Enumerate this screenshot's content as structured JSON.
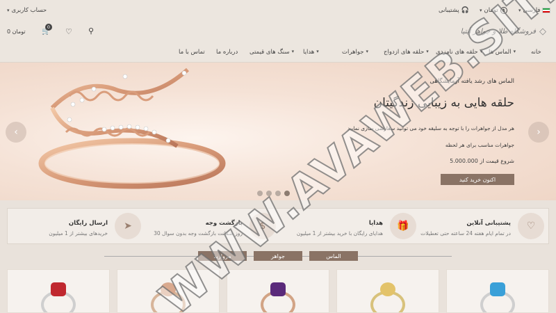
{
  "topbar": {
    "account_label": "حساب کاربری",
    "support_label": "پشتیبانی",
    "currency_label": "تومان",
    "language_label": "فارسی"
  },
  "header": {
    "logo_text": "فروشگاه طلا و جواهر آیتیا",
    "cart_count": "0",
    "cart_total": "0 تومان"
  },
  "nav": {
    "items": [
      "خانه",
      "الماس ها",
      "حلقه های نامزدی",
      "حلقه های ازدواج",
      "جواهرات",
      "هدایا",
      "سنگ های قیمتی",
      "درباره ما",
      "تماس با ما"
    ]
  },
  "hero": {
    "eyebrow": "الماس های رشد یافته آزمایشگاهی",
    "title": "حلقه هایی به زیبایی زندگیتان",
    "line1": "هر مدل از جواهرات را با توجه به سلیقه خود می توانید سفارشی سازی نمایید",
    "line2": "جواهرات مناسب برای هر لحظه",
    "price_prefix": "شروع قیمت از",
    "price_value": "5.000.000",
    "cta_label": "اکنون خرید کنید",
    "slides_count": 4,
    "active_slide": 4
  },
  "features": [
    {
      "title": "پشتیبانی آنلاین",
      "sub": "در تمام ایام هفته 24 ساعته حتی تعطیلات",
      "icon": "hand-heart-icon"
    },
    {
      "title": "هدایا",
      "sub": "هدایای رایگان با خرید بیشتر از 1 میلیون",
      "icon": "gift-icon"
    },
    {
      "title": "بازگشت وجه",
      "sub": "30 روز ضمانت بازگشت وجه بدون سوال",
      "icon": "money-hand-icon"
    },
    {
      "title": "ارسال رایگان",
      "sub": "خریدهای بیشتر از 1 میلیون",
      "icon": "paper-plane-icon"
    }
  ],
  "tabs": [
    "مروارید",
    "جواهر",
    "الماس"
  ],
  "products": [
    {
      "name": "ring-product-1",
      "gem_color": "#c0282f"
    },
    {
      "name": "ring-product-2",
      "gem_color": "#d9a98e"
    },
    {
      "name": "ring-product-3",
      "gem_color": "#5a2a7a"
    },
    {
      "name": "ring-product-4",
      "gem_color": "#e3c36a"
    },
    {
      "name": "ring-product-5",
      "gem_color": "#3aa0d8"
    }
  ],
  "watermark": "WWW.AVAWEB.SITE",
  "colors": {
    "accent": "#8a7365",
    "background": "#e9e2db"
  }
}
